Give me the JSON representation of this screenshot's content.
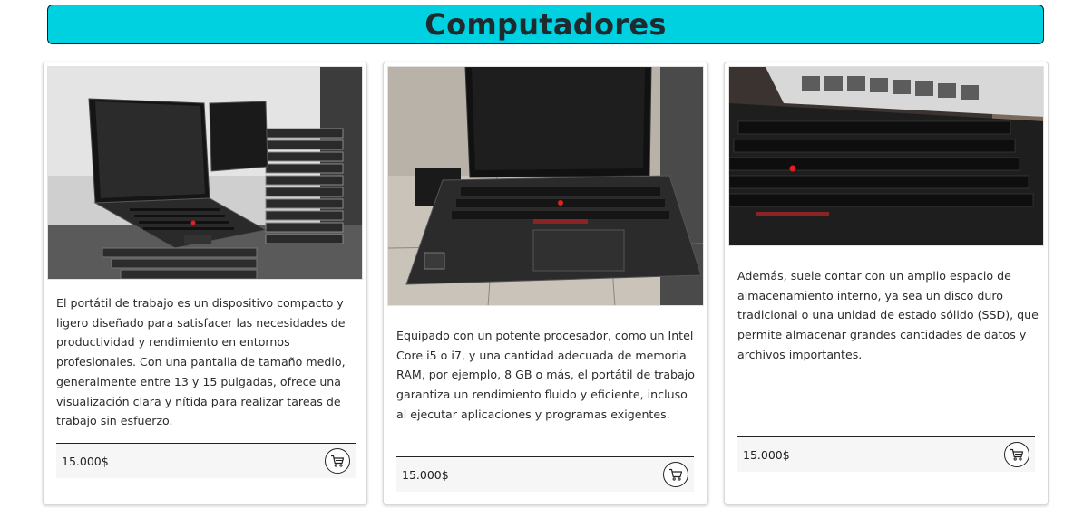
{
  "page": {
    "title": "Computadores"
  },
  "products": [
    {
      "image_alt": "laptop-stack-photo",
      "description": "El portátil de trabajo es un dispositivo compacto y ligero diseñado para satisfacer las necesidades de productividad y rendimiento en entornos profesionales. Con una pantalla de tamaño medio, generalmente entre 13 y 15 pulgadas, ofrece una visualización clara y nítida para realizar tareas de trabajo sin esfuerzo.",
      "price": "15.000$",
      "cart_icon": "shopping-cart-icon"
    },
    {
      "image_alt": "open-laptop-photo",
      "description": "Equipado con un potente procesador, como un Intel Core i5 o i7, y una cantidad adecuada de memoria RAM, por ejemplo, 8 GB o más, el portátil de trabajo garantiza un rendimiento fluido y eficiente, incluso al ejecutar aplicaciones y programas exigentes.",
      "price": "15.000$",
      "cart_icon": "shopping-cart-icon"
    },
    {
      "image_alt": "laptop-keyboard-closeup-photo",
      "description": "Además, suele contar con un amplio espacio de almacenamiento interno, ya sea un disco duro tradicional o una unidad de estado sólido (SSD), que permite almacenar grandes cantidades de datos y archivos importantes.",
      "price": "15.000$",
      "cart_icon": "shopping-cart-icon"
    }
  ],
  "colors": {
    "header_bg": "#00d1e0",
    "card_border": "#d8d8d8",
    "price_bg": "#f6f6f6"
  }
}
